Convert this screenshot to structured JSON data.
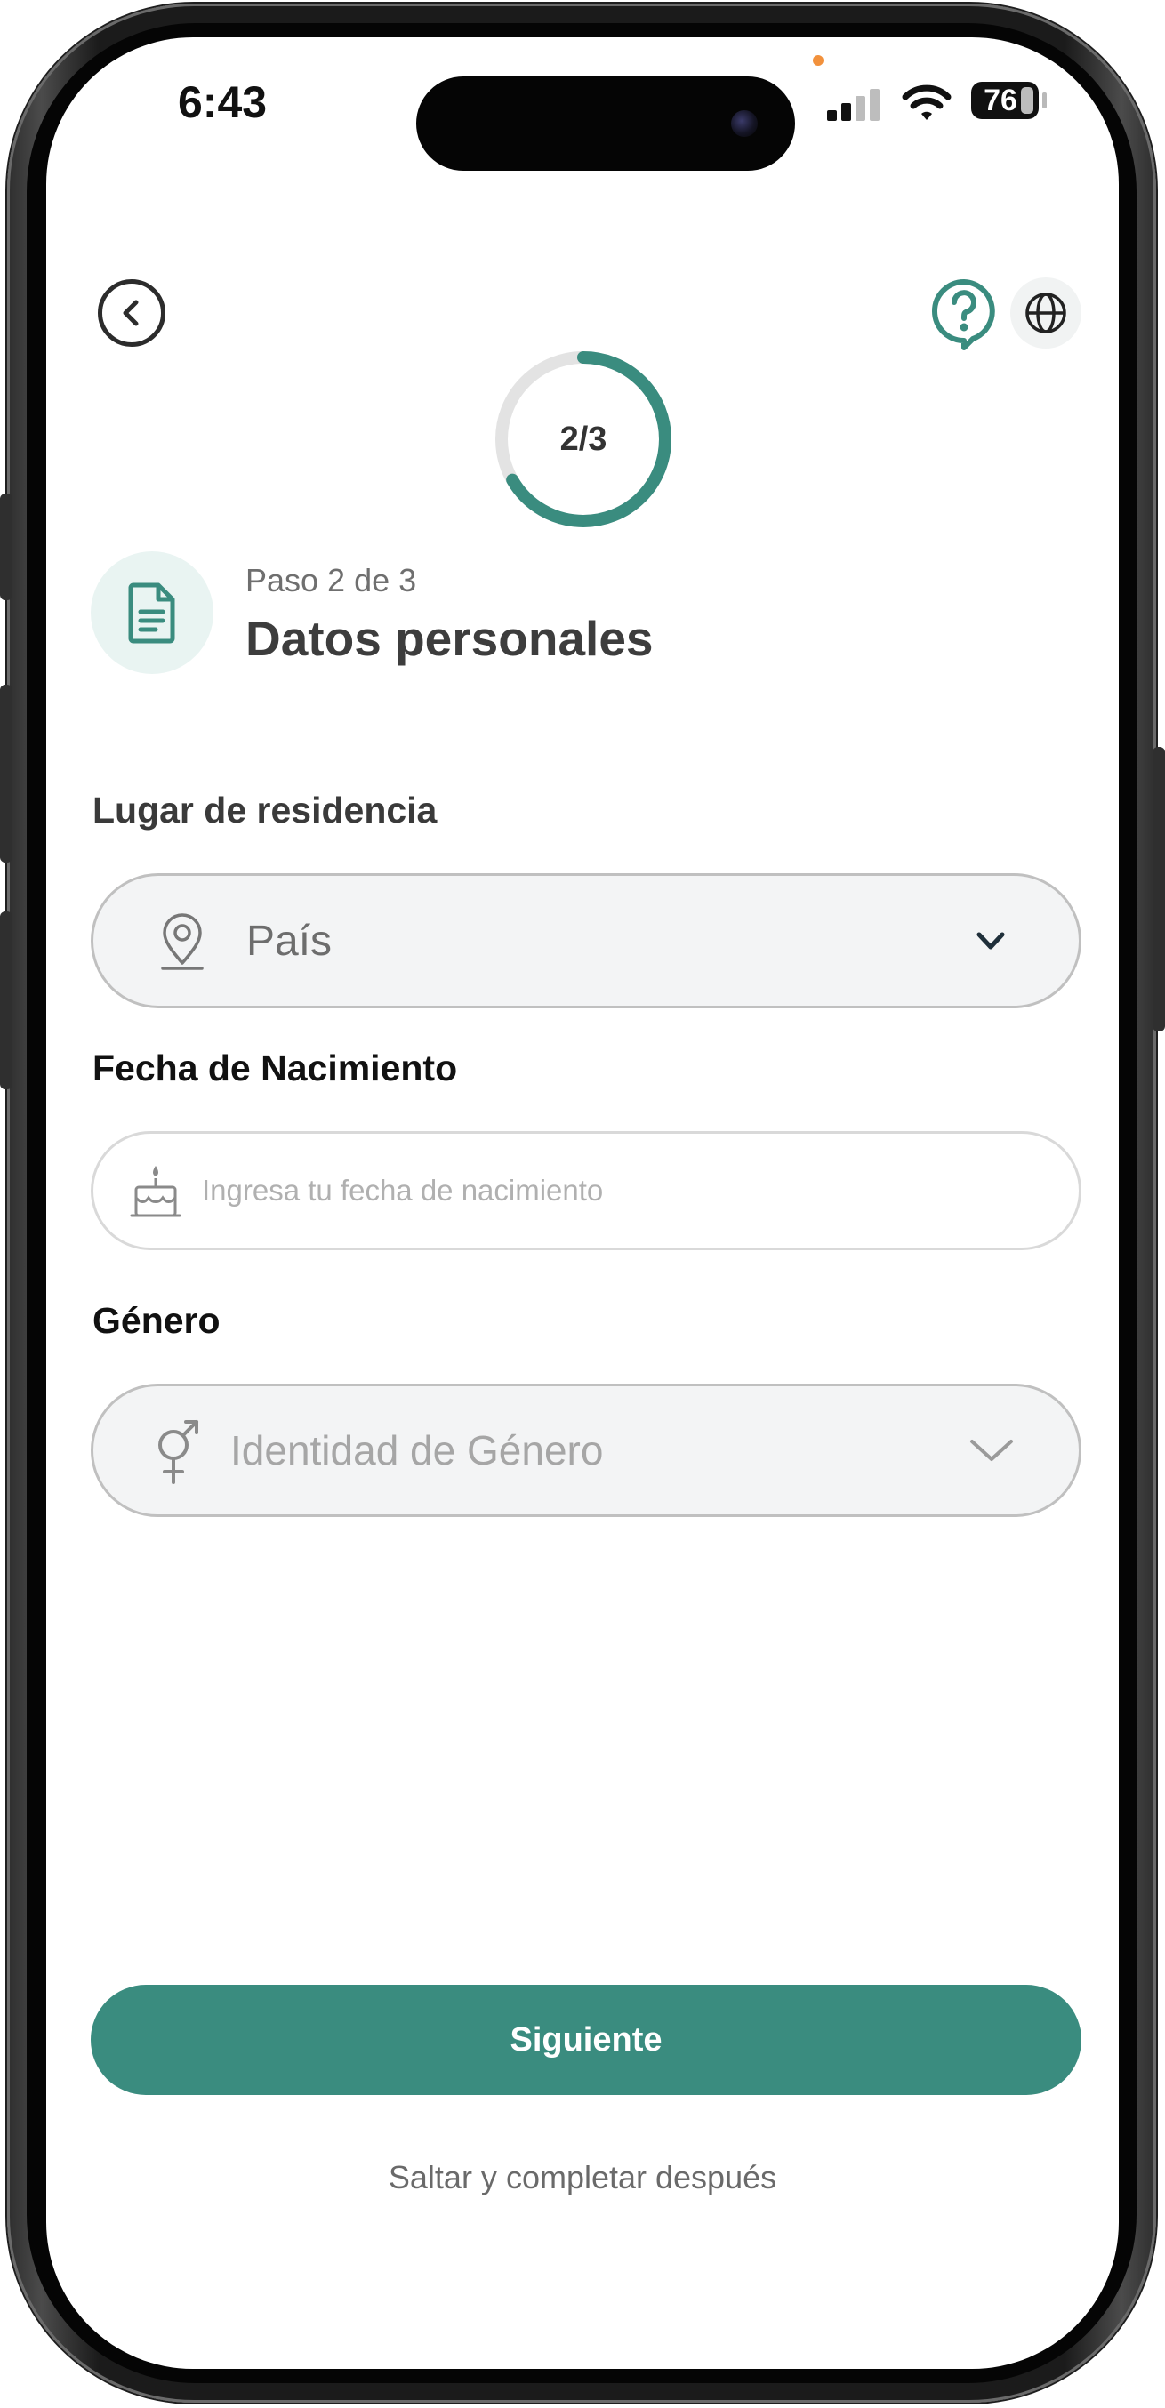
{
  "status_bar": {
    "time": "6:43",
    "battery": "76"
  },
  "header": {
    "progress_label": "2/3",
    "progress_fraction": 0.667,
    "accent_color": "#3a8c7f"
  },
  "step": {
    "caption": "Paso 2 de 3",
    "title": "Datos personales"
  },
  "form": {
    "residence": {
      "label": "Lugar de residencia",
      "value": "País",
      "icon": "location-pin-icon"
    },
    "birthdate": {
      "label": "Fecha de Nacimiento",
      "placeholder": "Ingresa tu fecha de nacimiento",
      "icon": "birthday-cake-icon"
    },
    "gender": {
      "label": "Género",
      "value": "Identidad de Género",
      "icon": "gender-symbol-icon"
    }
  },
  "actions": {
    "next_label": "Siguiente",
    "skip_label": "Saltar y completar después"
  }
}
